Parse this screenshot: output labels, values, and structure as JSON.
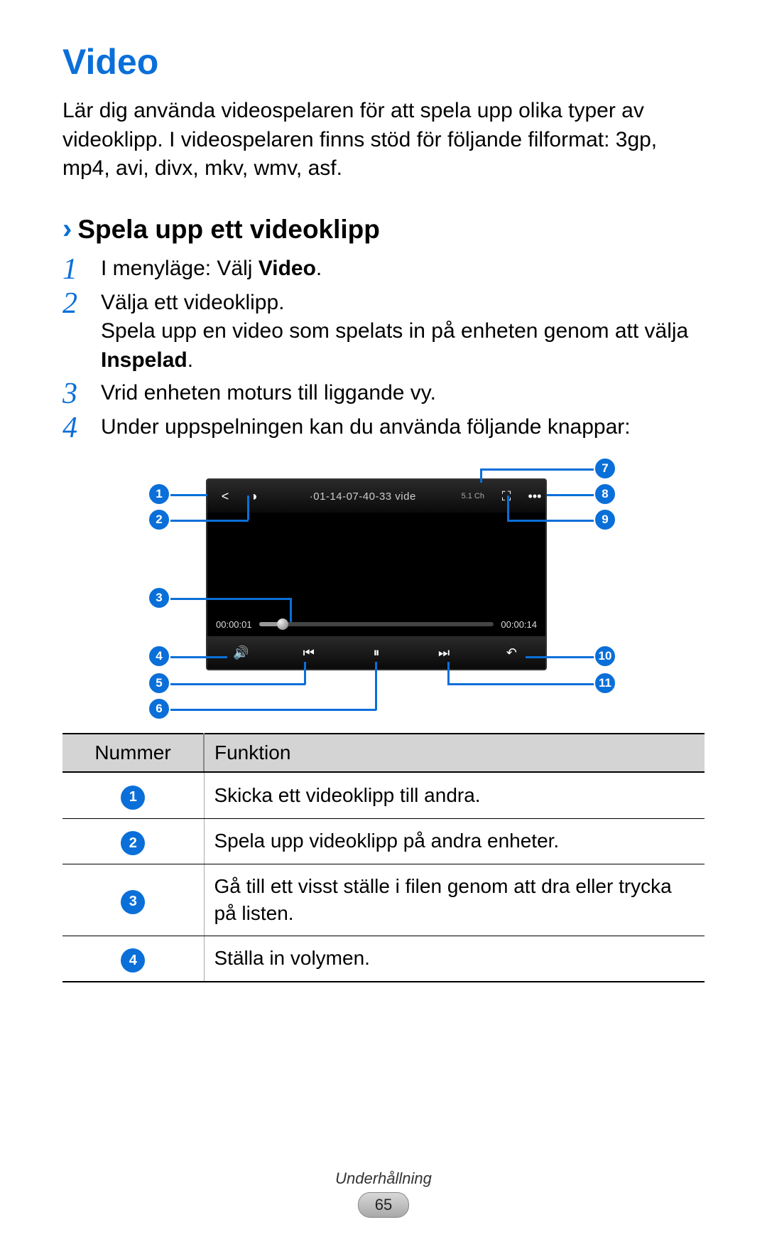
{
  "title": "Video",
  "intro": "Lär dig använda videospelaren för att spela upp olika typer av videoklipp. I videospelaren finns stöd för följande filformat: 3gp, mp4, avi, divx, mkv, wmv, asf.",
  "section": {
    "chevron": "›",
    "title": "Spela upp ett videoklipp"
  },
  "steps": [
    {
      "num": "1",
      "pre": "I menyläge: Välj ",
      "bold": "Video",
      "post": "."
    },
    {
      "num": "2",
      "pre": "Välja ett videoklipp.\nSpela upp en video som spelats in på enheten genom att välja ",
      "bold": "Inspelad",
      "post": "."
    },
    {
      "num": "3",
      "pre": "Vrid enheten moturs till liggande vy.",
      "bold": "",
      "post": ""
    },
    {
      "num": "4",
      "pre": "Under uppspelningen kan du använda följande knappar:",
      "bold": "",
      "post": ""
    }
  ],
  "player": {
    "title": "·01-14-07-40-33  vide",
    "channel": "5.1 Ch",
    "elapsed": "00:00:01",
    "total": "00:00:14"
  },
  "callouts": [
    "1",
    "2",
    "3",
    "4",
    "5",
    "6",
    "7",
    "8",
    "9",
    "10",
    "11"
  ],
  "table": {
    "head_num": "Nummer",
    "head_func": "Funktion",
    "rows": [
      {
        "n": "1",
        "text": "Skicka ett videoklipp till andra."
      },
      {
        "n": "2",
        "text": "Spela upp videoklipp på andra enheter."
      },
      {
        "n": "3",
        "text": "Gå till ett visst ställe i filen genom att dra eller trycka på listen."
      },
      {
        "n": "4",
        "text": "Ställa in volymen."
      }
    ]
  },
  "footer": {
    "section": "Underhållning",
    "page": "65"
  }
}
